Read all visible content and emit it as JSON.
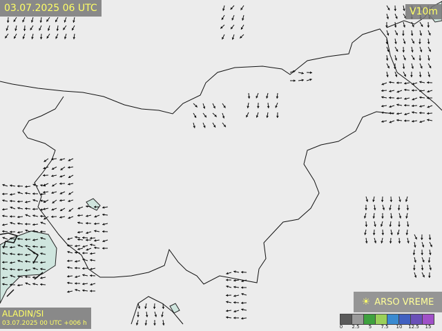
{
  "map": {
    "valid_time": "03.07.2025 06 UTC",
    "parameter": "V10m",
    "model": "ALADIN/SI",
    "run_info": "03.07.2025 00 UTC +006 h",
    "brand": "ARSO VREME",
    "brand_icon": "sun-icon"
  },
  "legend": {
    "ticks": [
      "0",
      "2.5",
      "5",
      "7.5",
      "10",
      "12.5",
      "15"
    ],
    "colors": [
      "#5a5a5a",
      "#9a9a9a",
      "#3fa13f",
      "#9ad05a",
      "#3a8ad0",
      "#4060c0",
      "#6a50b8",
      "#a050c8"
    ]
  },
  "colors": {
    "background": "#ececec",
    "border": "#111111",
    "sea": "#cfe5de",
    "label_text": "#ffff66"
  }
}
